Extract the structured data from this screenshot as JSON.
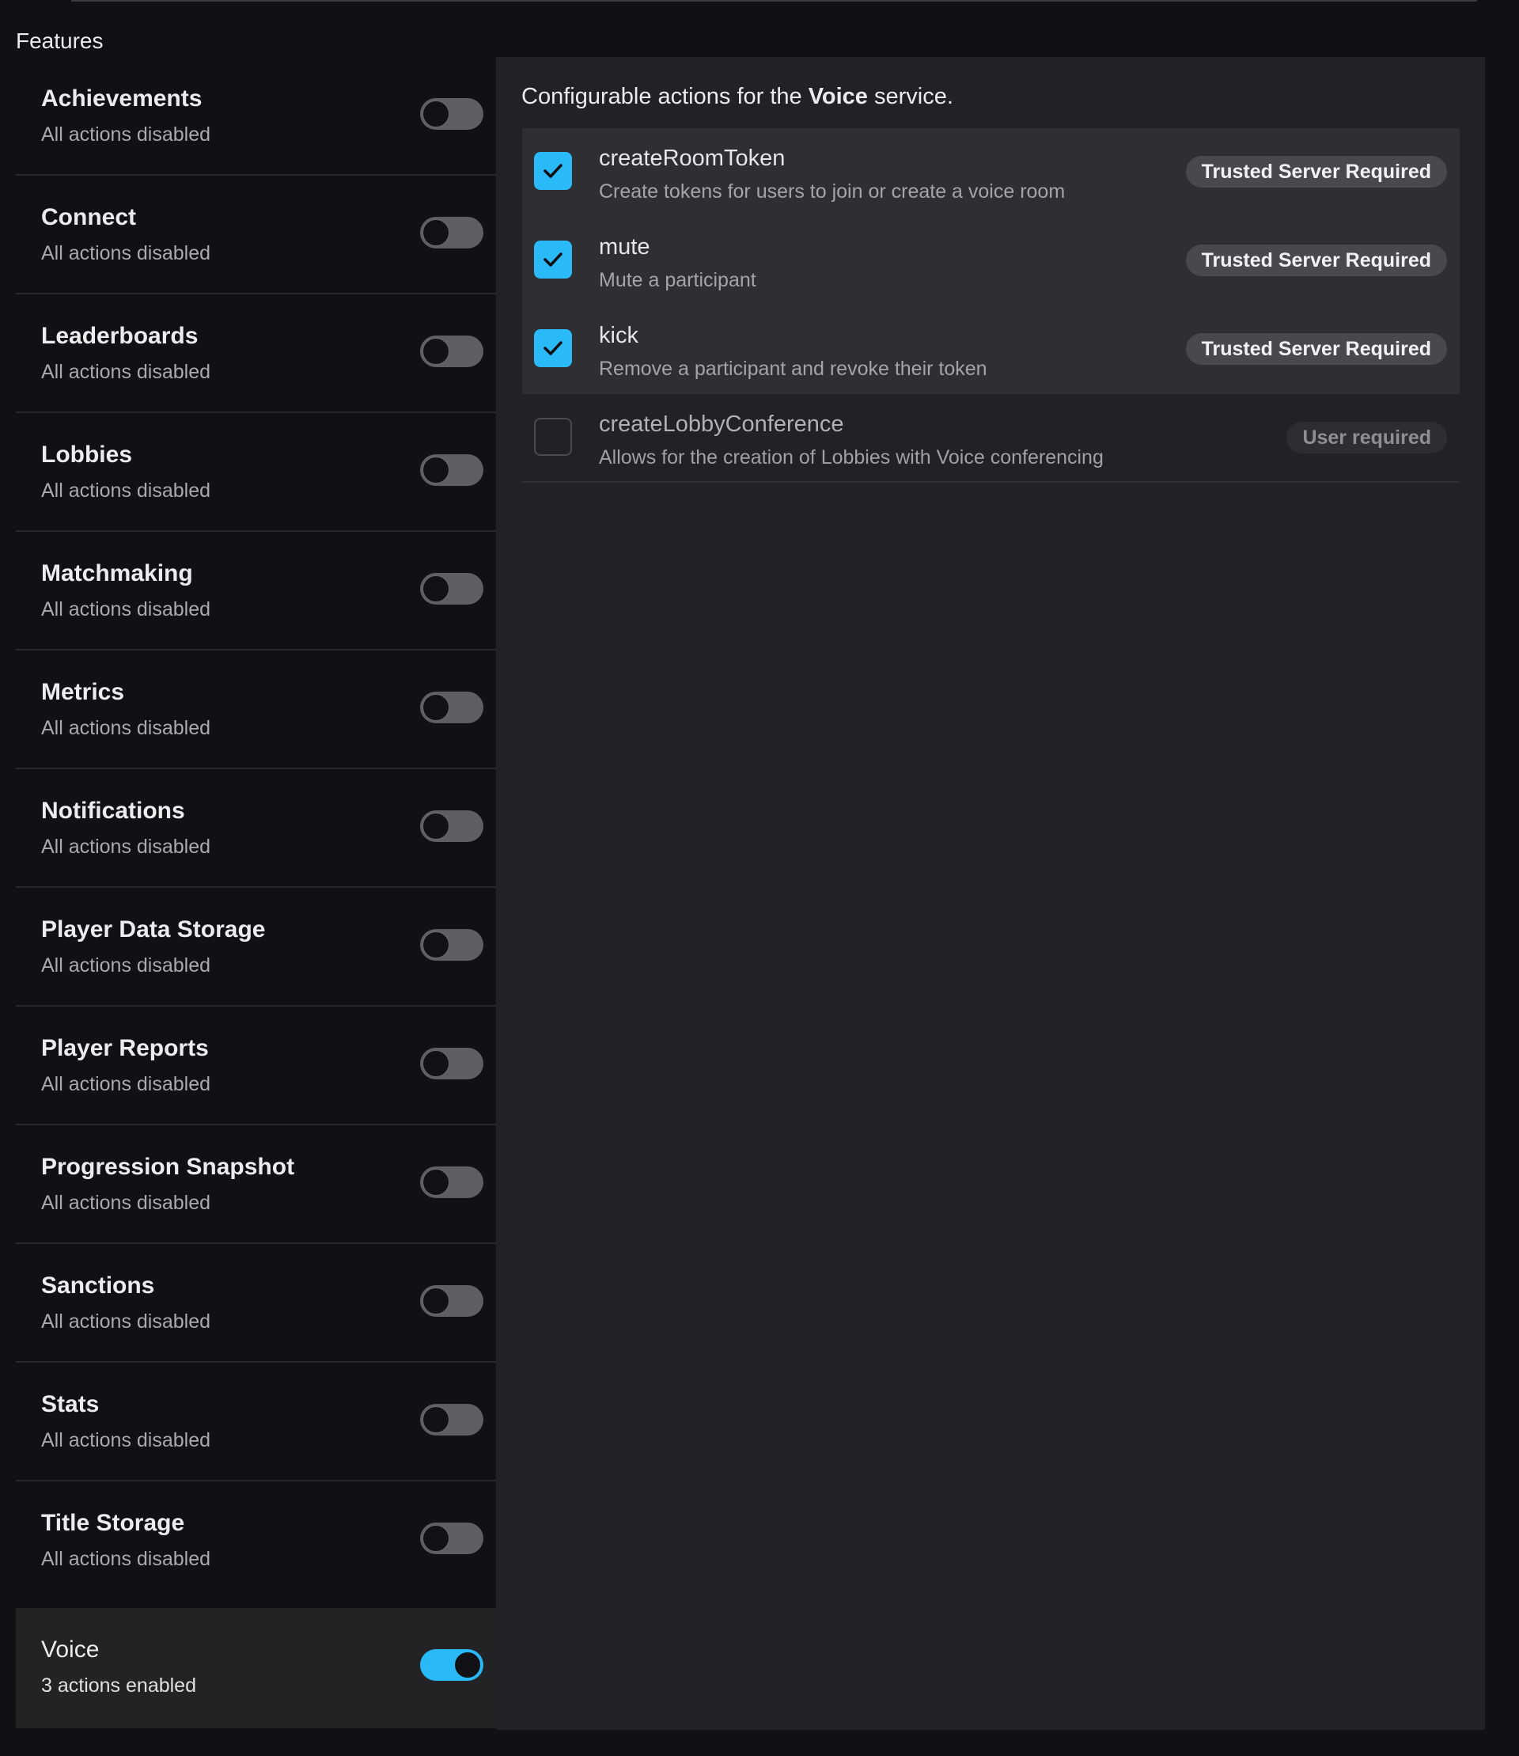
{
  "sidebar": {
    "title": "Features",
    "items": [
      {
        "name": "Achievements",
        "status": "All actions disabled",
        "enabled": false
      },
      {
        "name": "Connect",
        "status": "All actions disabled",
        "enabled": false
      },
      {
        "name": "Leaderboards",
        "status": "All actions disabled",
        "enabled": false
      },
      {
        "name": "Lobbies",
        "status": "All actions disabled",
        "enabled": false
      },
      {
        "name": "Matchmaking",
        "status": "All actions disabled",
        "enabled": false
      },
      {
        "name": "Metrics",
        "status": "All actions disabled",
        "enabled": false
      },
      {
        "name": "Notifications",
        "status": "All actions disabled",
        "enabled": false
      },
      {
        "name": "Player Data Storage",
        "status": "All actions disabled",
        "enabled": false
      },
      {
        "name": "Player Reports",
        "status": "All actions disabled",
        "enabled": false
      },
      {
        "name": "Progression Snapshot",
        "status": "All actions disabled",
        "enabled": false
      },
      {
        "name": "Sanctions",
        "status": "All actions disabled",
        "enabled": false
      },
      {
        "name": "Stats",
        "status": "All actions disabled",
        "enabled": false
      },
      {
        "name": "Title Storage",
        "status": "All actions disabled",
        "enabled": false
      },
      {
        "name": "Voice",
        "status": "3 actions enabled",
        "enabled": true,
        "selected": true
      }
    ]
  },
  "panel": {
    "heading_prefix": "Configurable actions for the ",
    "heading_service": "Voice",
    "heading_suffix": " service.",
    "actions": [
      {
        "name": "createRoomToken",
        "description": "Create tokens for users to join or create a voice room",
        "checked": true,
        "badge": "Trusted Server Required"
      },
      {
        "name": "mute",
        "description": "Mute a participant",
        "checked": true,
        "badge": "Trusted Server Required"
      },
      {
        "name": "kick",
        "description": "Remove a participant and revoke their token",
        "checked": true,
        "badge": "Trusted Server Required"
      },
      {
        "name": "createLobbyConference",
        "description": "Allows for the creation of Lobbies with Voice conferencing",
        "checked": false,
        "badge": "User required"
      }
    ]
  },
  "colors": {
    "accent": "#29b9f7",
    "background": "#111015",
    "panel": "#212126",
    "selected_group": "#2e2e33"
  }
}
